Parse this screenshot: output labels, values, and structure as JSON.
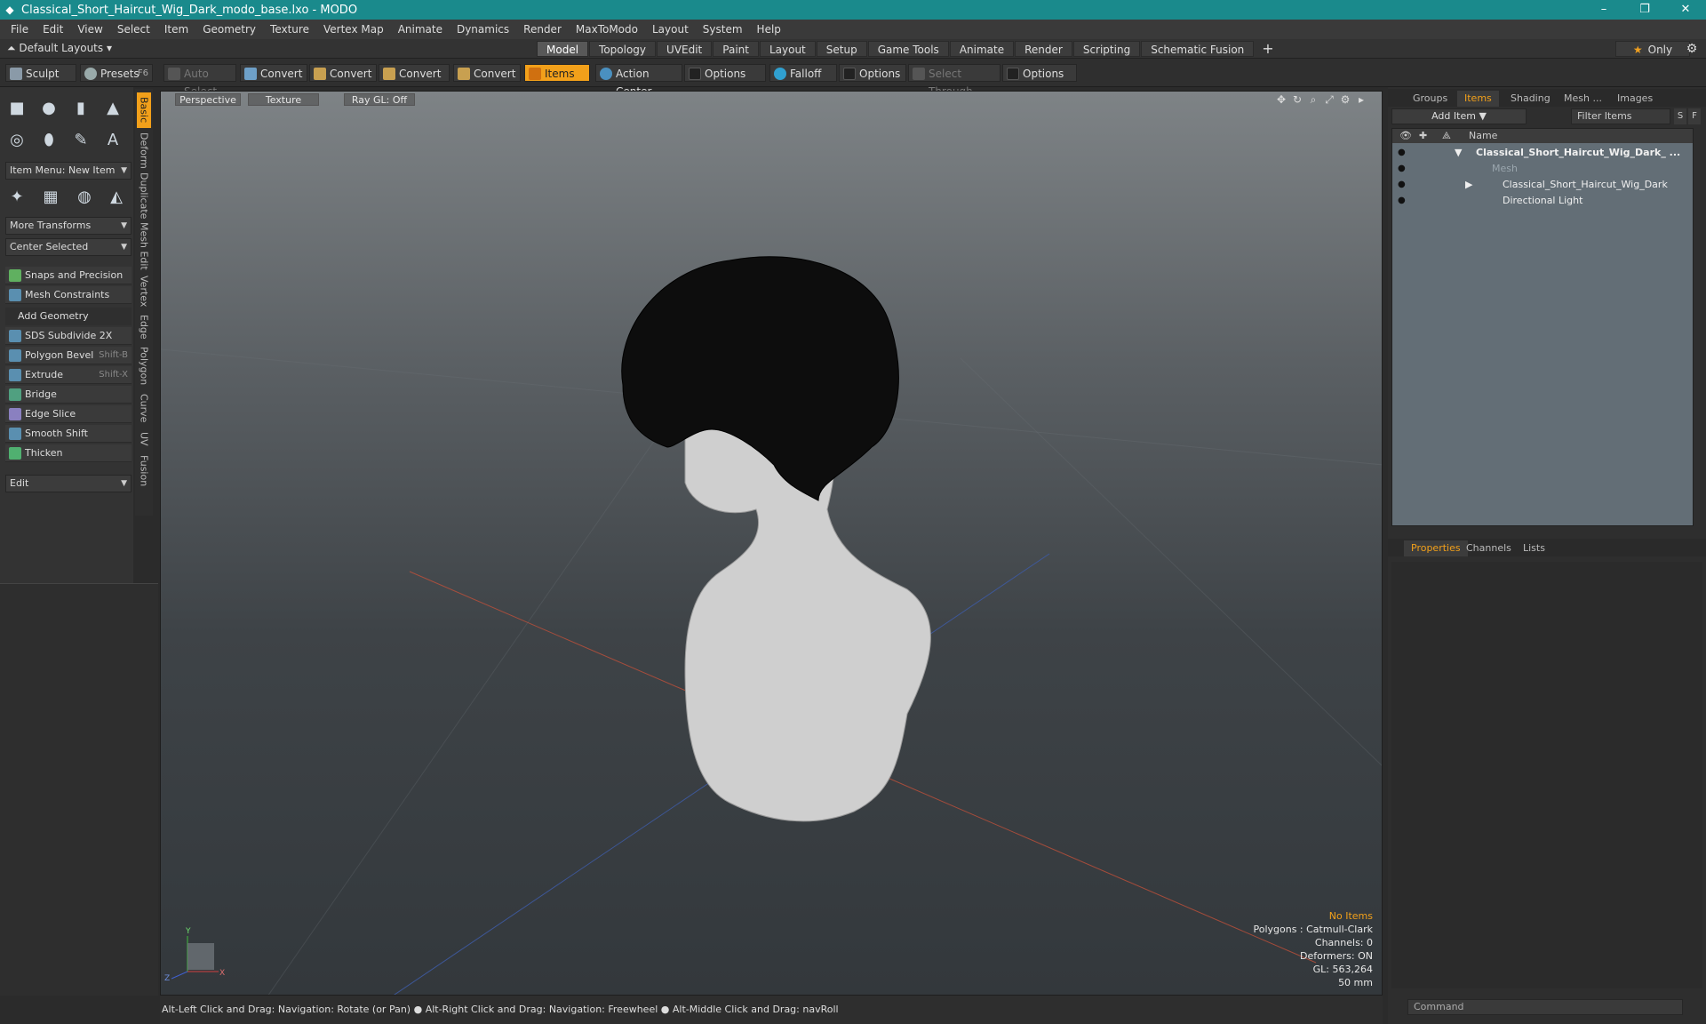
{
  "window": {
    "title": "Classical_Short_Haircut_Wig_Dark_modo_base.lxo - MODO",
    "minimize": "–",
    "maximize": "❐",
    "close": "✕"
  },
  "menu": [
    "File",
    "Edit",
    "View",
    "Select",
    "Item",
    "Geometry",
    "Texture",
    "Vertex Map",
    "Animate",
    "Dynamics",
    "Render",
    "MaxToModo",
    "Layout",
    "System",
    "Help"
  ],
  "layoutbar": {
    "default_layouts": "Default Layouts ▾",
    "tabs": [
      "Model",
      "Topology",
      "UVEdit",
      "Paint",
      "Layout",
      "Setup",
      "Game Tools",
      "Animate",
      "Render",
      "Scripting",
      "Schematic Fusion"
    ],
    "active_tab": "Model",
    "plus": "+",
    "only": "Only",
    "gear": "⚙"
  },
  "toolbar": {
    "sculpt": "Sculpt",
    "presets": "Presets",
    "presets_key": "F6",
    "auto_select": "Auto Select",
    "convert1": "Convert",
    "convert2": "Convert",
    "convert3": "Convert",
    "convert4": "Convert",
    "items": "Items",
    "action_center": "Action Center",
    "options1": "Options",
    "falloff": "Falloff",
    "options2": "Options",
    "select_through": "Select Through",
    "options3": "Options"
  },
  "leftpanel": {
    "item_menu": "Item Menu: New Item",
    "more_transforms": "More Transforms",
    "center_selected": "Center Selected",
    "snaps": "Snaps and Precision",
    "mesh_constraints": "Mesh Constraints",
    "add_geometry": "Add Geometry",
    "tools": [
      {
        "label": "SDS Subdivide 2X",
        "shortcut": ""
      },
      {
        "label": "Polygon Bevel",
        "shortcut": "Shift-B"
      },
      {
        "label": "Extrude",
        "shortcut": "Shift-X"
      },
      {
        "label": "Bridge",
        "shortcut": ""
      },
      {
        "label": "Edge Slice",
        "shortcut": ""
      },
      {
        "label": "Smooth Shift",
        "shortcut": ""
      },
      {
        "label": "Thicken",
        "shortcut": ""
      }
    ],
    "edit": "Edit",
    "vtabs": [
      "Basic",
      "Deform",
      "Duplicate",
      "Mesh Edit",
      "Vertex",
      "Edge",
      "Polygon",
      "Curve",
      "UV",
      "Fusion"
    ]
  },
  "viewport": {
    "perspective": "Perspective",
    "texture": "Texture",
    "raygl": "Ray GL: Off",
    "info": {
      "no_items": "No Items",
      "polygons": "Polygons : Catmull-Clark",
      "channels": "Channels: 0",
      "deformers": "Deformers: ON",
      "gl": "GL: 563,264",
      "focal": "50 mm"
    },
    "axis": {
      "y": "Y",
      "x": "X",
      "z": "Z"
    }
  },
  "statusbar": "Alt-Left Click and Drag: Navigation: Rotate (or Pan) ● Alt-Right Click and Drag: Navigation: Freewheel ● Alt-Middle Click and Drag: navRoll",
  "rightpanel": {
    "tabs": [
      "Groups",
      "Items",
      "Shading",
      "Mesh ...",
      "Images"
    ],
    "active_tab": "Items",
    "add_item": "Add Item",
    "filter_items": "Filter Items",
    "s_btn": "S",
    "f_btn": "F",
    "name_col": "Name",
    "tree": [
      {
        "label": "Classical_Short_Haircut_Wig_Dark_ ...",
        "indent": 0
      },
      {
        "label": "Mesh",
        "indent": 1
      },
      {
        "label": "Classical_Short_Haircut_Wig_Dark",
        "indent": 1
      },
      {
        "label": "Directional Light",
        "indent": 1
      }
    ],
    "prop_tabs": [
      "Properties",
      "Channels",
      "Lists"
    ],
    "prop_active": "Properties",
    "command_placeholder": "Command"
  }
}
